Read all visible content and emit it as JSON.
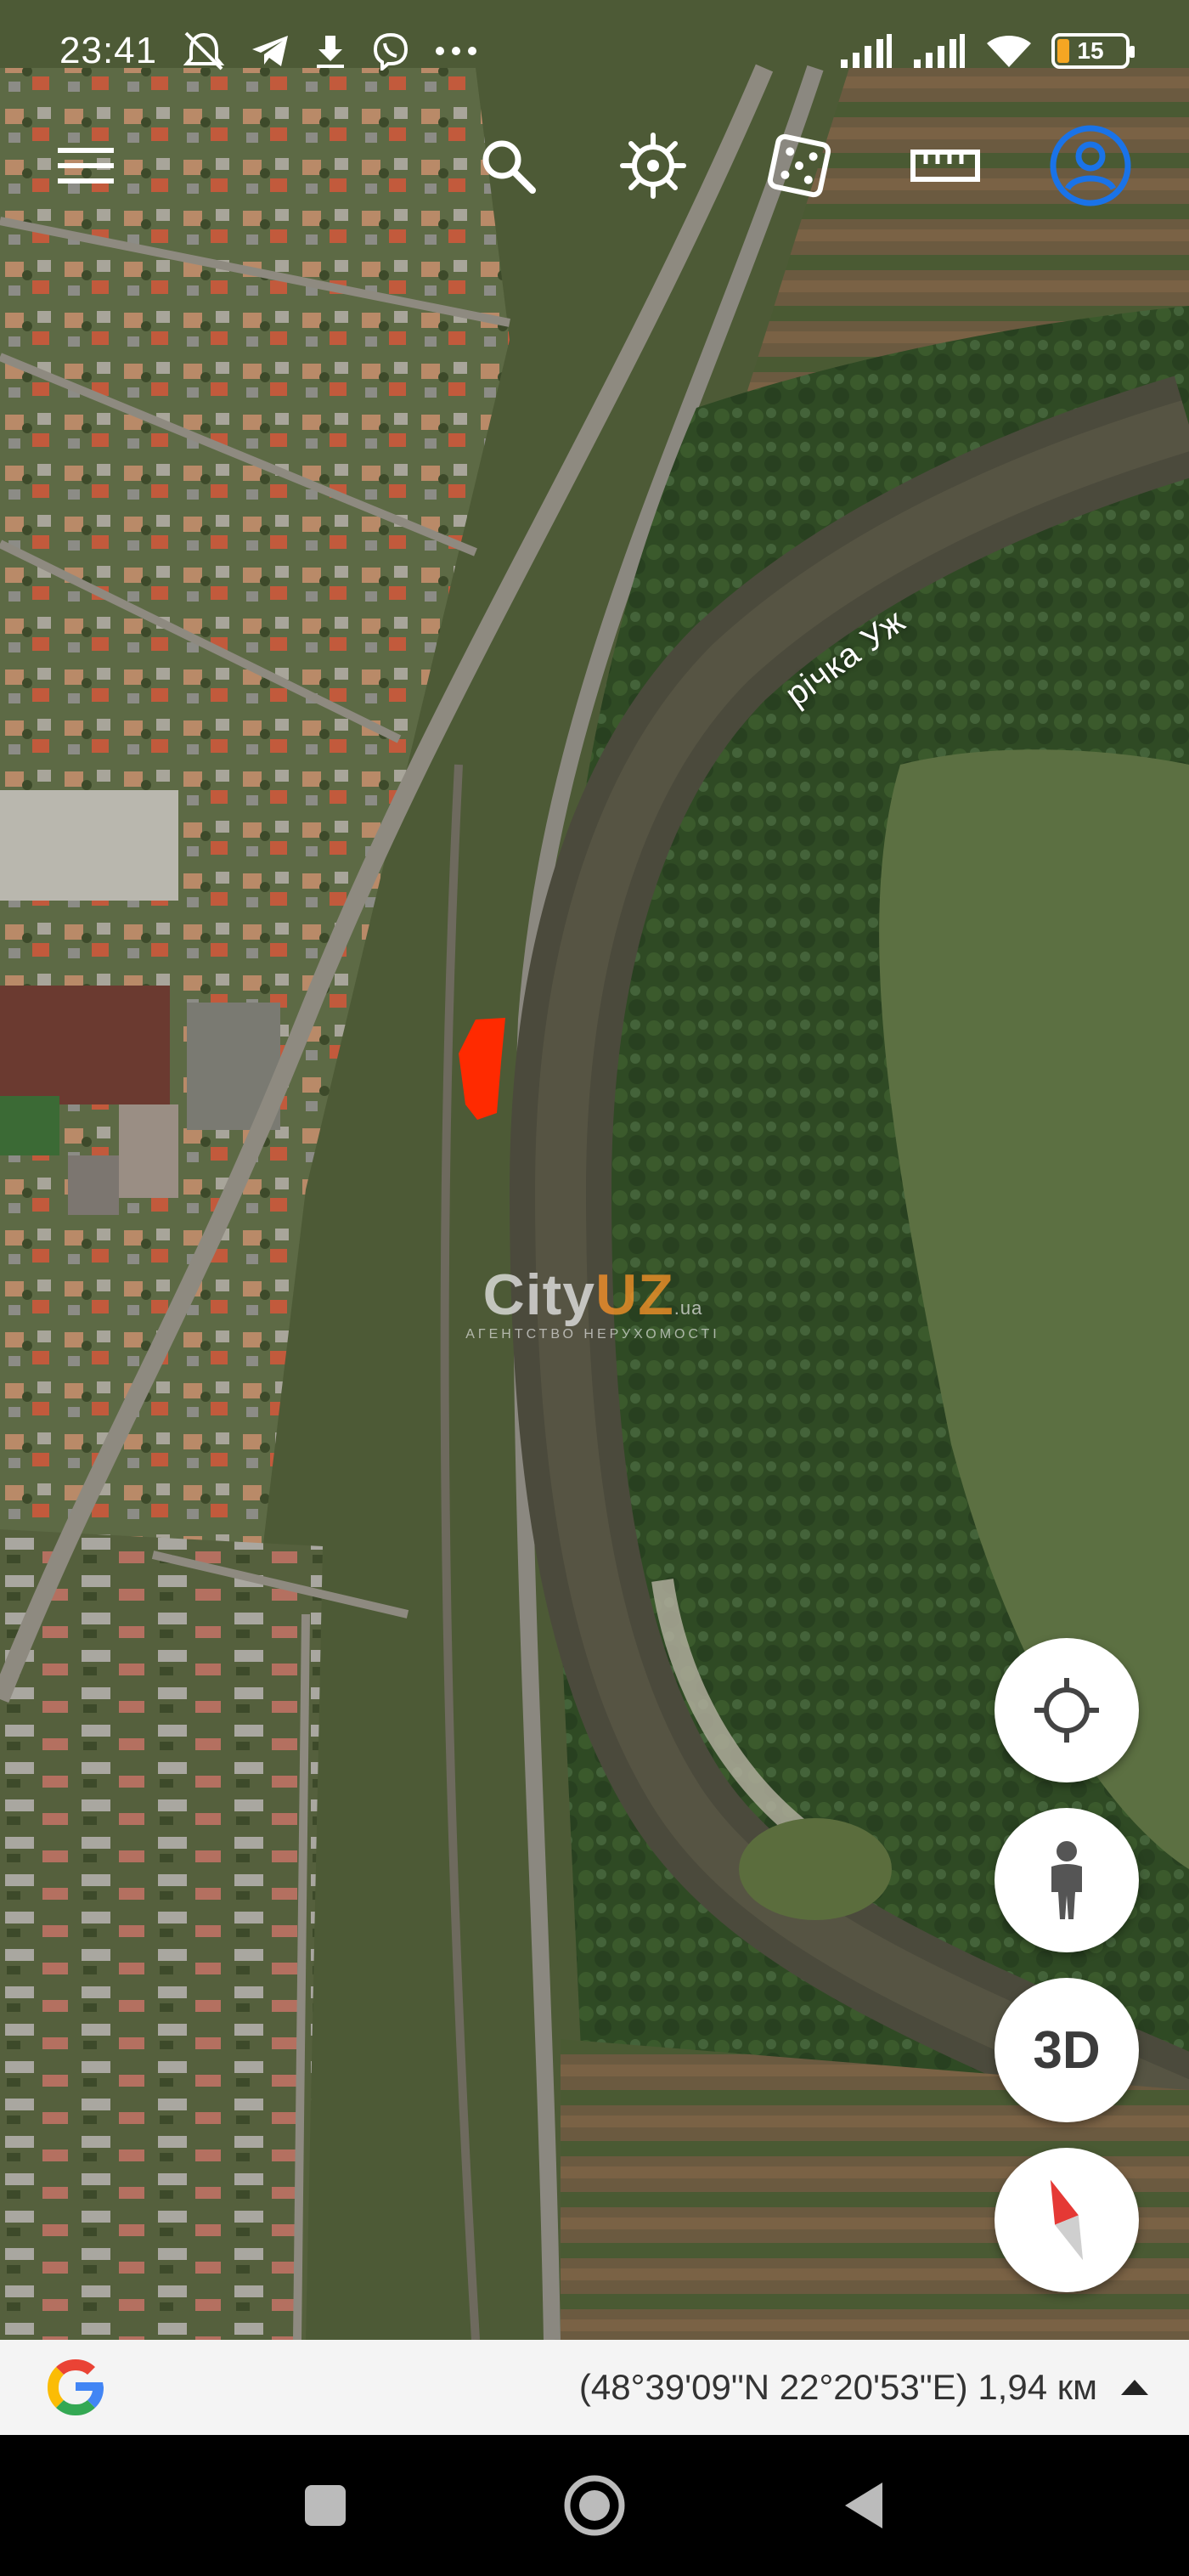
{
  "status_bar": {
    "time": "23:41",
    "battery": "15",
    "icons": [
      "mute-icon",
      "telegram-icon",
      "download-icon",
      "viber-icon",
      "more-dots-icon"
    ],
    "right_icons": [
      "signal-icon",
      "signal-icon",
      "wifi-icon",
      "battery-icon"
    ]
  },
  "toolbar": {
    "buttons": [
      "menu-icon",
      "search-icon",
      "voyager-wheel-icon",
      "dice-icon",
      "ruler-icon",
      "account-icon"
    ],
    "accent_color": "#1a73e8"
  },
  "map": {
    "river_label": "річка Уж",
    "marker_color": "#ff2a00"
  },
  "watermark": {
    "city": "City",
    "uz": "UZ",
    "tld": ".ua",
    "subtitle": "АГЕНТСТВО НЕРУХОМОСТІ"
  },
  "fabs": {
    "three_d_label": "3D"
  },
  "bottom_bar": {
    "coords": "(48°39'09\"N 22°20'53\"E) 1,94 км"
  },
  "google_colors": [
    "#4285f4",
    "#ea4335",
    "#fbbc05",
    "#34a853"
  ]
}
